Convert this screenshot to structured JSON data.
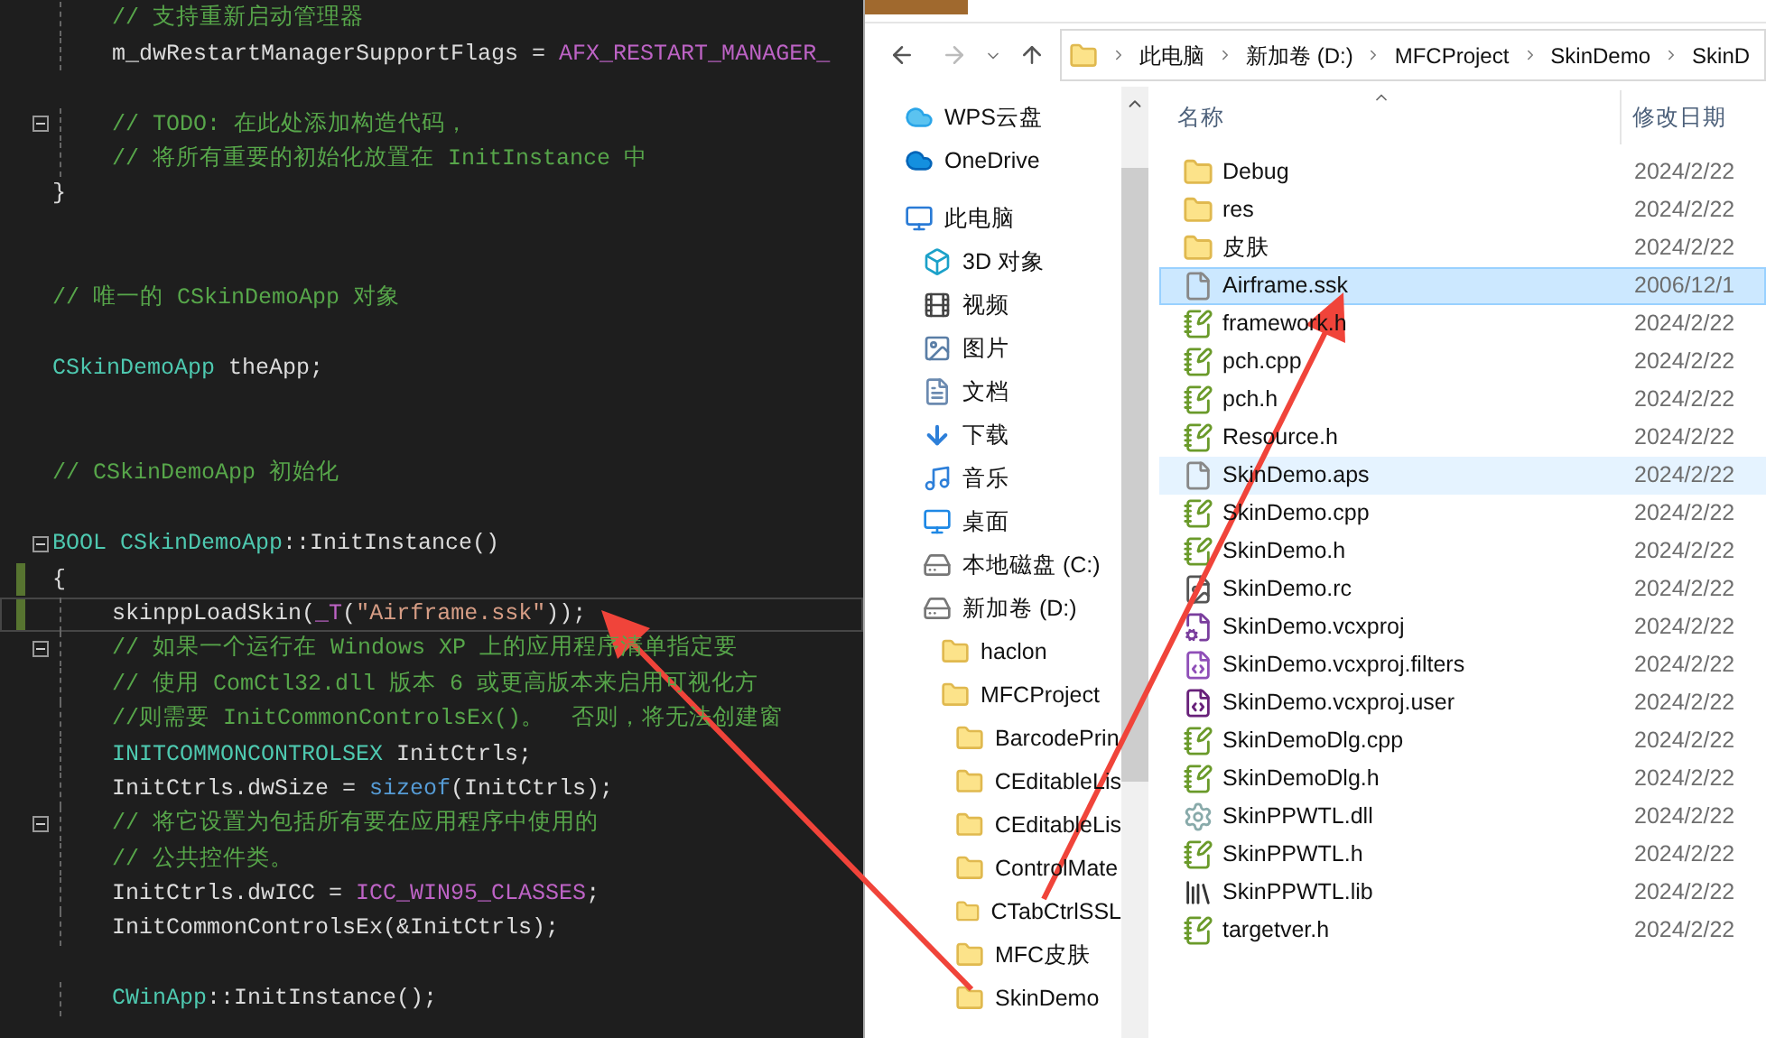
{
  "editor": {
    "lines": [
      {
        "kind": "code",
        "indented": true,
        "fold": false,
        "changed": false,
        "current": false,
        "segments": [
          {
            "kind": "comment",
            "text": "// 支持重新启动管理器"
          }
        ]
      },
      {
        "kind": "code",
        "indented": true,
        "fold": false,
        "changed": false,
        "current": false,
        "segments": [
          {
            "kind": "plain",
            "text": "m_dwRestartManagerSupportFlags = "
          },
          {
            "kind": "macro",
            "text": "AFX_RESTART_MANAGER_"
          }
        ]
      },
      {
        "kind": "blank"
      },
      {
        "kind": "code",
        "indented": true,
        "fold": true,
        "changed": false,
        "current": false,
        "segments": [
          {
            "kind": "comment",
            "text": "// TODO: 在此处添加构造代码，"
          }
        ]
      },
      {
        "kind": "code",
        "indented": true,
        "fold": false,
        "changed": false,
        "current": false,
        "segments": [
          {
            "kind": "comment",
            "text": "// 将所有重要的初始化放置在 InitInstance 中"
          }
        ]
      },
      {
        "kind": "code",
        "indented": false,
        "fold": false,
        "changed": false,
        "current": false,
        "segments": [
          {
            "kind": "plain",
            "text": "}"
          }
        ]
      },
      {
        "kind": "blank"
      },
      {
        "kind": "blank"
      },
      {
        "kind": "code",
        "indented": false,
        "fold": false,
        "changed": false,
        "current": false,
        "segments": [
          {
            "kind": "comment",
            "text": "// 唯一的 CSkinDemoApp 对象"
          }
        ]
      },
      {
        "kind": "blank"
      },
      {
        "kind": "code",
        "indented": false,
        "fold": false,
        "changed": false,
        "current": false,
        "segments": [
          {
            "kind": "type",
            "text": "CSkinDemoApp"
          },
          {
            "kind": "plain",
            "text": " theApp;"
          }
        ]
      },
      {
        "kind": "blank"
      },
      {
        "kind": "blank"
      },
      {
        "kind": "code",
        "indented": false,
        "fold": false,
        "changed": false,
        "current": false,
        "segments": [
          {
            "kind": "comment",
            "text": "// CSkinDemoApp 初始化"
          }
        ]
      },
      {
        "kind": "blank"
      },
      {
        "kind": "code",
        "indented": false,
        "fold": true,
        "changed": false,
        "current": false,
        "segments": [
          {
            "kind": "type",
            "text": "BOOL CSkinDemoApp"
          },
          {
            "kind": "plain",
            "text": "::InitInstance()"
          }
        ]
      },
      {
        "kind": "code",
        "indented": false,
        "fold": false,
        "changed": true,
        "current": false,
        "segments": [
          {
            "kind": "plain",
            "text": "{"
          }
        ]
      },
      {
        "kind": "code",
        "indented": true,
        "fold": false,
        "changed": true,
        "current": true,
        "segments": [
          {
            "kind": "plain",
            "text": "skinppLoadSkin("
          },
          {
            "kind": "macro",
            "text": "_T"
          },
          {
            "kind": "plain",
            "text": "("
          },
          {
            "kind": "string",
            "text": "\"Airframe.ssk\""
          },
          {
            "kind": "plain",
            "text": "));"
          }
        ]
      },
      {
        "kind": "code",
        "indented": true,
        "fold": true,
        "changed": false,
        "current": false,
        "segments": [
          {
            "kind": "comment",
            "text": "// 如果一个运行在 Windows XP 上的应用程序清单指定要"
          }
        ]
      },
      {
        "kind": "code",
        "indented": true,
        "fold": false,
        "changed": false,
        "current": false,
        "segments": [
          {
            "kind": "comment",
            "text": "// 使用 ComCtl32.dll 版本 6 或更高版本来启用可视化方"
          }
        ]
      },
      {
        "kind": "code",
        "indented": true,
        "fold": false,
        "changed": false,
        "current": false,
        "segments": [
          {
            "kind": "comment",
            "text": "//则需要 InitCommonControlsEx()。  否则，将无法创建窗"
          }
        ]
      },
      {
        "kind": "code",
        "indented": true,
        "fold": false,
        "changed": false,
        "current": false,
        "segments": [
          {
            "kind": "type",
            "text": "INITCOMMONCONTROLSEX"
          },
          {
            "kind": "plain",
            "text": " InitCtrls;"
          }
        ]
      },
      {
        "kind": "code",
        "indented": true,
        "fold": false,
        "changed": false,
        "current": false,
        "segments": [
          {
            "kind": "plain",
            "text": "InitCtrls.dwSize = "
          },
          {
            "kind": "keyword",
            "text": "sizeof"
          },
          {
            "kind": "plain",
            "text": "(InitCtrls);"
          }
        ]
      },
      {
        "kind": "code",
        "indented": true,
        "fold": true,
        "changed": false,
        "current": false,
        "segments": [
          {
            "kind": "comment",
            "text": "// 将它设置为包括所有要在应用程序中使用的"
          }
        ]
      },
      {
        "kind": "code",
        "indented": true,
        "fold": false,
        "changed": false,
        "current": false,
        "segments": [
          {
            "kind": "comment",
            "text": "// 公共控件类。"
          }
        ]
      },
      {
        "kind": "code",
        "indented": true,
        "fold": false,
        "changed": false,
        "current": false,
        "segments": [
          {
            "kind": "plain",
            "text": "InitCtrls.dwICC = "
          },
          {
            "kind": "macro",
            "text": "ICC_WIN95_CLASSES"
          },
          {
            "kind": "plain",
            "text": ";"
          }
        ]
      },
      {
        "kind": "code",
        "indented": true,
        "fold": false,
        "changed": false,
        "current": false,
        "segments": [
          {
            "kind": "plain",
            "text": "InitCommonControlsEx(&InitCtrls);"
          }
        ]
      },
      {
        "kind": "blank"
      },
      {
        "kind": "code",
        "indented": true,
        "fold": false,
        "changed": false,
        "current": false,
        "segments": [
          {
            "kind": "type",
            "text": "CWinApp"
          },
          {
            "kind": "plain",
            "text": "::InitInstance();"
          }
        ]
      }
    ]
  },
  "explorer": {
    "breadcrumbs": [
      "此电脑",
      "新加卷 (D:)",
      "MFCProject",
      "SkinDemo",
      "SkinD"
    ],
    "nav": [
      {
        "label": "WPS云盘",
        "kind": "wps"
      },
      {
        "label": "OneDrive",
        "kind": "onedrive"
      },
      {
        "label": "此电脑",
        "kind": "pc",
        "children": [
          {
            "label": "3D 对象",
            "kind": "objects"
          },
          {
            "label": "视频",
            "kind": "video"
          },
          {
            "label": "图片",
            "kind": "pictures"
          },
          {
            "label": "文档",
            "kind": "documents"
          },
          {
            "label": "下载",
            "kind": "downloads"
          },
          {
            "label": "音乐",
            "kind": "music"
          },
          {
            "label": "桌面",
            "kind": "desktop"
          },
          {
            "label": "本地磁盘 (C:)",
            "kind": "drive"
          },
          {
            "label": "新加卷 (D:)",
            "kind": "drive",
            "children": [
              {
                "label": "haclon",
                "kind": "folder"
              },
              {
                "label": "MFCProject",
                "kind": "folder",
                "children": [
                  {
                    "label": "BarcodePrin",
                    "kind": "folder"
                  },
                  {
                    "label": "CEditableLis",
                    "kind": "folder"
                  },
                  {
                    "label": "CEditableLis",
                    "kind": "folder"
                  },
                  {
                    "label": "ControlMate",
                    "kind": "folder"
                  },
                  {
                    "label": "CTabCtrlSSL",
                    "kind": "folder"
                  },
                  {
                    "label": "MFC皮肤",
                    "kind": "folder"
                  },
                  {
                    "label": "SkinDemo",
                    "kind": "folder"
                  }
                ]
              }
            ]
          }
        ]
      }
    ],
    "columns": [
      "名称",
      "修改日期"
    ],
    "files": [
      {
        "name": "Debug",
        "date": "2024/2/22",
        "kind": "folder",
        "selected": false,
        "hovered": false
      },
      {
        "name": "res",
        "date": "2024/2/22",
        "kind": "folder",
        "selected": false,
        "hovered": false
      },
      {
        "name": "皮肤",
        "date": "2024/2/22",
        "kind": "folder",
        "selected": false,
        "hovered": false
      },
      {
        "name": "Airframe.ssk",
        "date": "2006/12/1",
        "kind": "blank",
        "selected": true,
        "hovered": false
      },
      {
        "name": "framework.h",
        "date": "2024/2/22",
        "kind": "source",
        "selected": false,
        "hovered": false
      },
      {
        "name": "pch.cpp",
        "date": "2024/2/22",
        "kind": "source",
        "selected": false,
        "hovered": false
      },
      {
        "name": "pch.h",
        "date": "2024/2/22",
        "kind": "source",
        "selected": false,
        "hovered": false
      },
      {
        "name": "Resource.h",
        "date": "2024/2/22",
        "kind": "source",
        "selected": false,
        "hovered": false
      },
      {
        "name": "SkinDemo.aps",
        "date": "2024/2/22",
        "kind": "blank",
        "selected": false,
        "hovered": true
      },
      {
        "name": "SkinDemo.cpp",
        "date": "2024/2/22",
        "kind": "source",
        "selected": false,
        "hovered": false
      },
      {
        "name": "SkinDemo.h",
        "date": "2024/2/22",
        "kind": "source",
        "selected": false,
        "hovered": false
      },
      {
        "name": "SkinDemo.rc",
        "date": "2024/2/22",
        "kind": "resource",
        "selected": false,
        "hovered": false
      },
      {
        "name": "SkinDemo.vcxproj",
        "date": "2024/2/22",
        "kind": "project",
        "selected": false,
        "hovered": false
      },
      {
        "name": "SkinDemo.vcxproj.filters",
        "date": "2024/2/22",
        "kind": "filters",
        "selected": false,
        "hovered": false
      },
      {
        "name": "SkinDemo.vcxproj.user",
        "date": "2024/2/22",
        "kind": "user",
        "selected": false,
        "hovered": false
      },
      {
        "name": "SkinDemoDlg.cpp",
        "date": "2024/2/22",
        "kind": "source",
        "selected": false,
        "hovered": false
      },
      {
        "name": "SkinDemoDlg.h",
        "date": "2024/2/22",
        "kind": "source",
        "selected": false,
        "hovered": false
      },
      {
        "name": "SkinPPWTL.dll",
        "date": "2024/2/22",
        "kind": "dll",
        "selected": false,
        "hovered": false
      },
      {
        "name": "SkinPPWTL.h",
        "date": "2024/2/22",
        "kind": "source",
        "selected": false,
        "hovered": false
      },
      {
        "name": "SkinPPWTL.lib",
        "date": "2024/2/22",
        "kind": "lib",
        "selected": false,
        "hovered": false
      },
      {
        "name": "targetver.h",
        "date": "2024/2/22",
        "kind": "source",
        "selected": false,
        "hovered": false
      }
    ]
  }
}
